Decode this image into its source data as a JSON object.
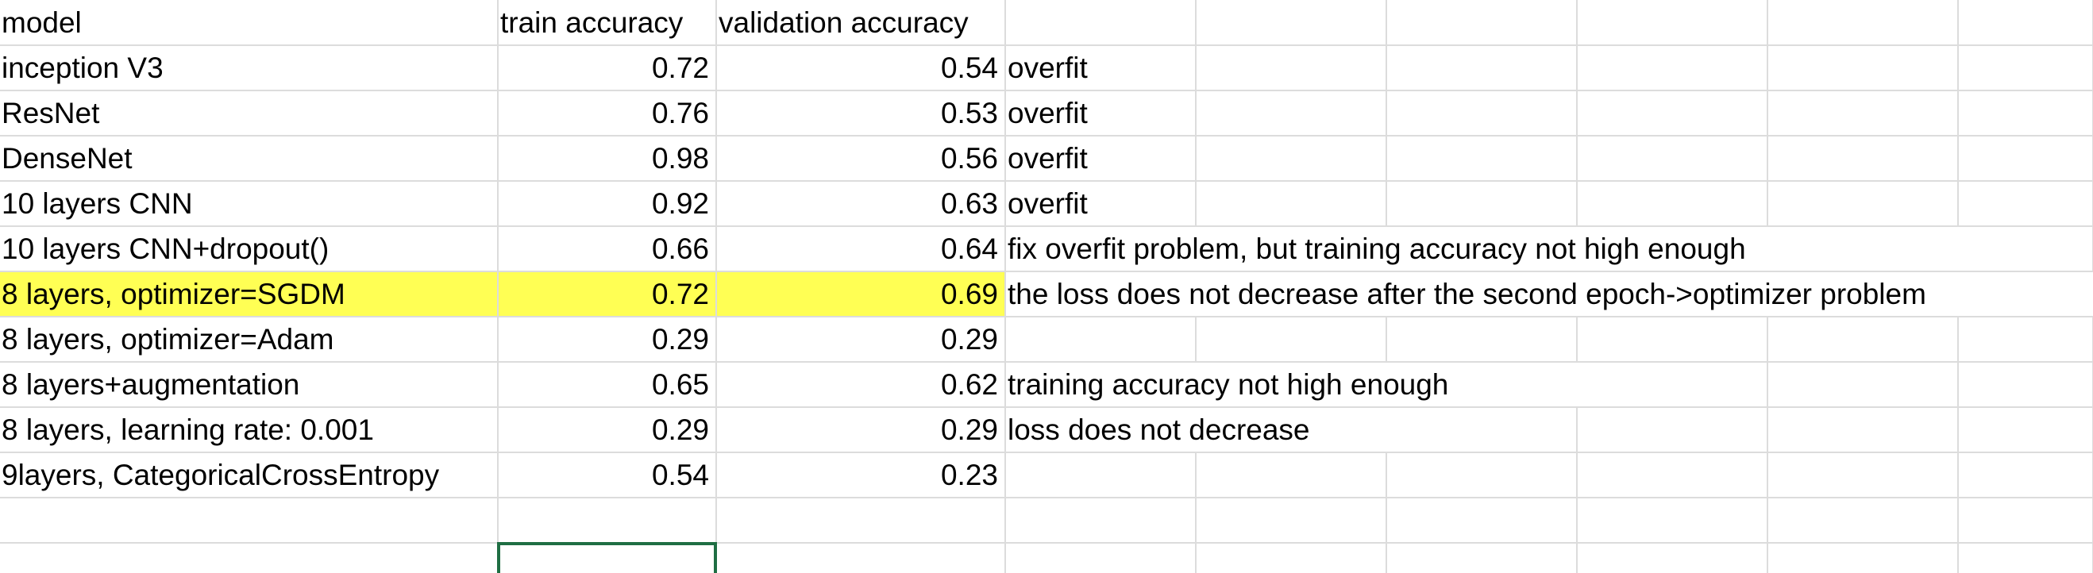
{
  "sheet": {
    "headers": [
      "model",
      "train accuracy",
      "validation accuracy"
    ],
    "rows": [
      {
        "model": "inception V3",
        "train": "0.72",
        "validation": "0.54",
        "note": "overfit",
        "highlight": false
      },
      {
        "model": "ResNet",
        "train": "0.76",
        "validation": "0.53",
        "note": "overfit",
        "highlight": false
      },
      {
        "model": "DenseNet",
        "train": "0.98",
        "validation": "0.56",
        "note": "overfit",
        "highlight": false
      },
      {
        "model": "10 layers CNN",
        "train": "0.92",
        "validation": "0.63",
        "note": "overfit",
        "highlight": false
      },
      {
        "model": "10 layers CNN+dropout()",
        "train": "0.66",
        "validation": "0.64",
        "note": "fix overfit problem, but training accuracy not high enough",
        "highlight": false
      },
      {
        "model": "8 layers, optimizer=SGDM",
        "train": "0.72",
        "validation": "0.69",
        "note": "the loss does not decrease after the second epoch->optimizer problem",
        "highlight": true
      },
      {
        "model": "8 layers, optimizer=Adam",
        "train": "0.29",
        "validation": "0.29",
        "note": "",
        "highlight": false
      },
      {
        "model": "8 layers+augmentation",
        "train": "0.65",
        "validation": "0.62",
        "note": "training accuracy not high enough",
        "highlight": false
      },
      {
        "model": "8 layers, learning rate: 0.001",
        "train": "0.29",
        "validation": "0.29",
        "note": "loss does not decrease",
        "highlight": false
      },
      {
        "model": "9layers,  CategoricalCrossEntropy",
        "train": "0.54",
        "validation": "0.23",
        "note": "",
        "highlight": false
      }
    ],
    "colors": {
      "highlight": "#ffff54",
      "gridline": "#dcdcdc",
      "selection_border": "#1f6e43"
    }
  }
}
